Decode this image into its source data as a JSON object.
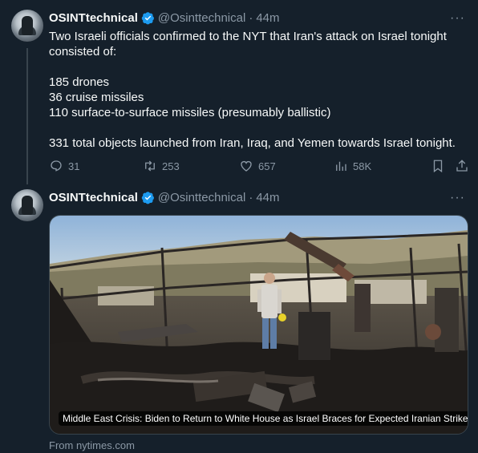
{
  "tweets": [
    {
      "display_name": "OSINTtechnical",
      "handle": "@Osinttechnical",
      "time": "44m",
      "more": "···",
      "lines": [
        "Two Israeli officials confirmed to the NYT that Iran's attack on Israel tonight consisted of:",
        "",
        "185 drones",
        "36 cruise missiles",
        "110 surface-to-surface missiles (presumably ballistic)",
        "",
        "331 total objects launched from Iran, Iraq, and Yemen towards Israel tonight."
      ],
      "actions": {
        "reply": "31",
        "retweet": "253",
        "like": "657",
        "views": "58K"
      }
    },
    {
      "display_name": "OSINTtechnical",
      "handle": "@Osinttechnical",
      "time": "44m",
      "more": "···",
      "card": {
        "caption": "Middle East Crisis: Biden to Return to White House as Israel Braces for Expected Iranian Strike",
        "source": "From nytimes.com"
      }
    }
  ],
  "colors": {
    "background": "#15202b",
    "text": "#f7f9f9",
    "secondary": "#8b98a5",
    "verified": "#1d9bf0"
  }
}
